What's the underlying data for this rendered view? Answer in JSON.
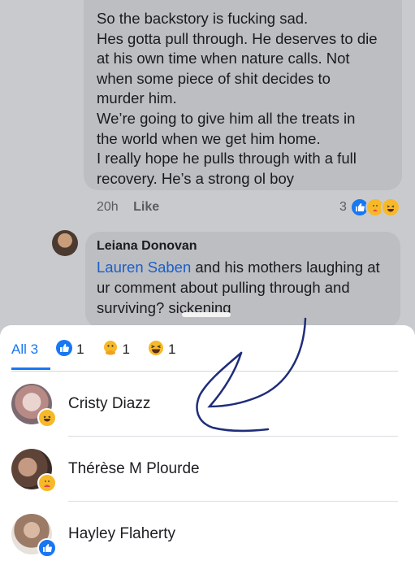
{
  "comment1": {
    "lines": [
      "So the backstory is fucking sad.",
      "Hes gotta pull through. He deserves to die",
      "at his own time when nature calls. Not",
      "when some piece of shit decides to",
      "murder him.",
      "We’re going to give him all the treats in",
      "the world when we get him home.",
      "I really hope he pulls through with a full",
      "recovery. He’s a strong ol boy"
    ],
    "time": "20h",
    "like_label": "Like",
    "reaction_count": "3"
  },
  "comment2": {
    "author": "Leiana Donovan",
    "mention": "Lauren Saben",
    "line1_rest": " and his mothers laughing at",
    "line2": "ur comment about pulling through and",
    "line3": "surviving? sickening"
  },
  "reactions_sheet": {
    "tabs": [
      {
        "label": "All 3",
        "icon": "",
        "active": true
      },
      {
        "label": "1",
        "icon": "like-icon",
        "active": false
      },
      {
        "label": "1",
        "icon": "care-icon",
        "active": false
      },
      {
        "label": "1",
        "icon": "haha-icon",
        "active": false
      }
    ],
    "reactors": [
      {
        "name": "Cristy Diazz",
        "reaction": "haha"
      },
      {
        "name": "Thérèse M Plourde",
        "reaction": "care"
      },
      {
        "name": "Hayley Flaherty",
        "reaction": "like"
      }
    ]
  },
  "colors": {
    "accent": "#1877f2",
    "annotation_ink": "#1f2d7a"
  }
}
